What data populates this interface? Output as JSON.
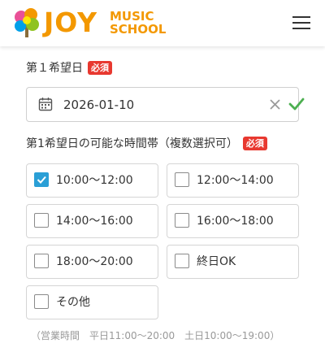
{
  "header": {
    "logo_main": "JOY",
    "logo_sub_line1": "MUSIC",
    "logo_sub_line2": "SCHOOL",
    "menu_icon": "hamburger-menu-icon",
    "brand_color": "#f39800"
  },
  "form": {
    "date_label": "第１希望日",
    "required_badge": "必須",
    "date_value": "2026-01-10",
    "calendar_icon": "calendar-icon",
    "clear_icon": "close-icon",
    "valid_icon": "check-icon",
    "time_label": "第1希望日の可能な時間帯（複数選択可）",
    "time_required_badge": "必須",
    "options": [
      {
        "label": "10:00〜12:00",
        "checked": true
      },
      {
        "label": "12:00〜14:00",
        "checked": false
      },
      {
        "label": "14:00〜16:00",
        "checked": false
      },
      {
        "label": "16:00〜18:00",
        "checked": false
      },
      {
        "label": "18:00〜20:00",
        "checked": false
      },
      {
        "label": "終日OK",
        "checked": false
      },
      {
        "label": "その他",
        "checked": false
      }
    ],
    "hours_note": "（営業時間　平日11:00〜20:00　土日10:00〜19:00）"
  },
  "colors": {
    "accent_check": "#2a9fd6",
    "required_red": "#e8382f",
    "valid_green": "#4caf50"
  }
}
